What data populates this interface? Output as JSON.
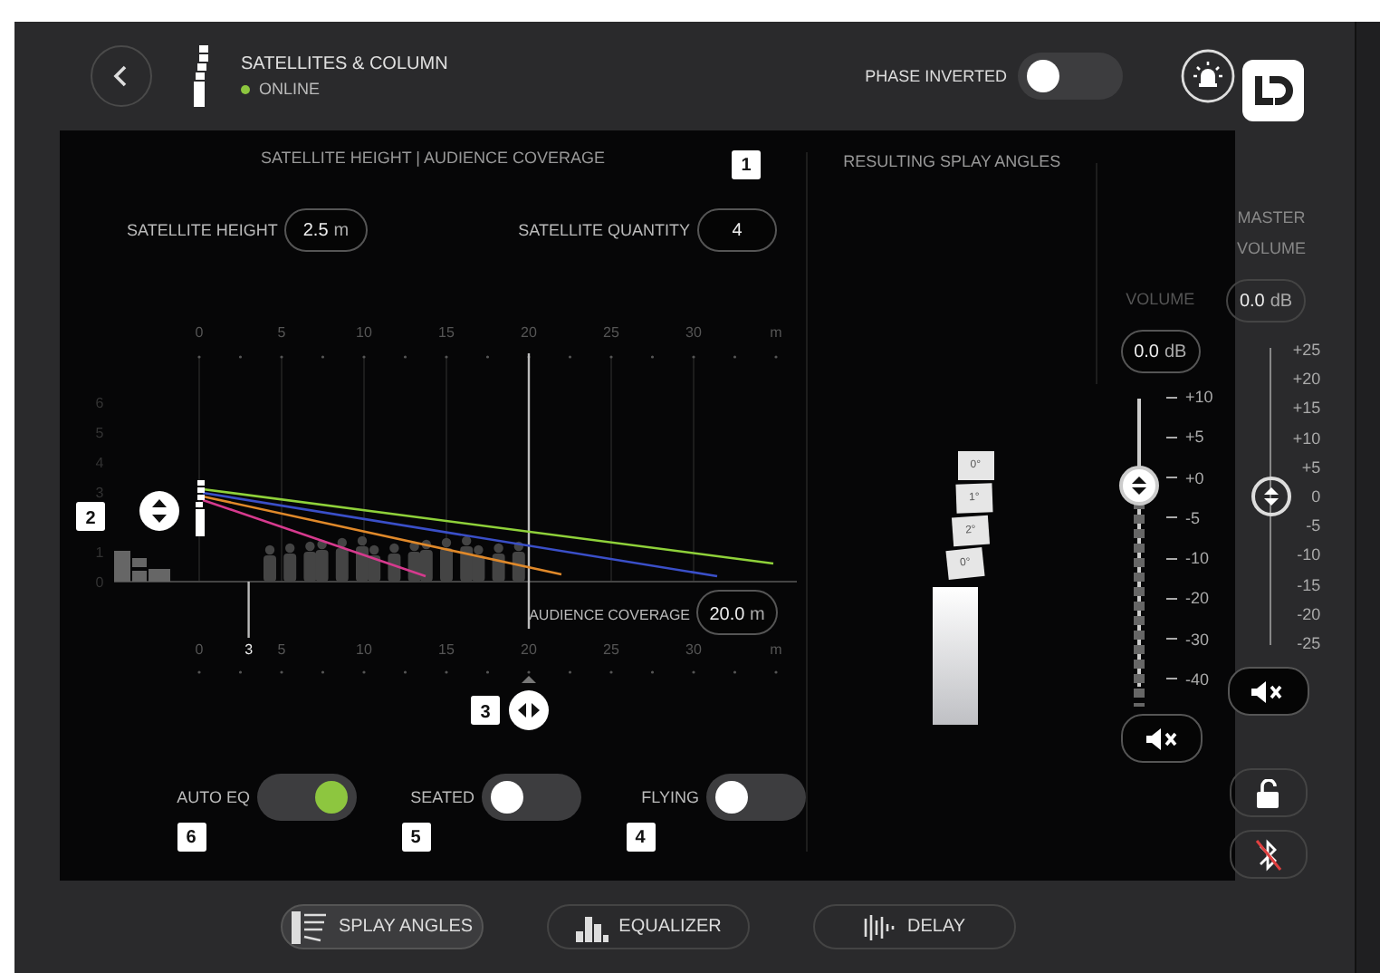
{
  "header": {
    "title": "SATELLITES & COLUMN",
    "status": {
      "label": "ONLINE",
      "online": true
    },
    "phase_inverted": {
      "label": "PHASE INVERTED",
      "on": false
    }
  },
  "coverage": {
    "title": "SATELLITE HEIGHT | AUDIENCE COVERAGE",
    "height_field": {
      "label": "SATELLITE HEIGHT",
      "value": "2.5",
      "unit": "m"
    },
    "quantity_field": {
      "label": "SATELLITE QUANTITY",
      "value": "4",
      "badge": "1"
    },
    "top_axis": [
      "0",
      "5",
      "10",
      "15",
      "20",
      "25",
      "30",
      "m"
    ],
    "height_axis": [
      "6",
      "5",
      "4",
      "3",
      "1",
      "0"
    ],
    "bottom_axis": [
      "0",
      "5",
      "10",
      "15",
      "20",
      "25",
      "30",
      "m"
    ],
    "position_marker": "3",
    "coverage_field": {
      "label": "AUDIENCE COVERAGE",
      "value": "20.0",
      "unit": "m"
    },
    "height_handle": {
      "badge": "2"
    },
    "coverage_handle": {
      "badge": "3"
    },
    "rays": [
      {
        "color": "#8fd13a"
      },
      {
        "color": "#3a4fc8"
      },
      {
        "color": "#e0892a"
      },
      {
        "color": "#d63a8e"
      }
    ],
    "switches": [
      {
        "label": "AUTO EQ",
        "on": true,
        "badge": "6"
      },
      {
        "label": "SEATED",
        "on": false,
        "badge": "5"
      },
      {
        "label": "FLYING",
        "on": false,
        "badge": "4"
      }
    ]
  },
  "splay": {
    "title": "RESULTING SPLAY ANGLES",
    "angles": [
      "0°",
      "1°",
      "2°",
      "0°"
    ]
  },
  "volume": {
    "label": "VOLUME",
    "value": "0.0",
    "unit": "dB",
    "level": 0.7,
    "scale": [
      "+10",
      "+5",
      "+0",
      "-5",
      "-10",
      "-20",
      "-30",
      "-40"
    ]
  },
  "master": {
    "label": "MASTER VOLUME",
    "value": "0.0",
    "unit": "dB",
    "level": 0.5,
    "scale": [
      "+25",
      "+20",
      "+15",
      "+10",
      "+5",
      "0",
      "-5",
      "-10",
      "-15",
      "-20",
      "-25"
    ]
  },
  "tabs": [
    {
      "label": "SPLAY ANGLES",
      "selected": true
    },
    {
      "label": "EQUALIZER",
      "selected": false
    },
    {
      "label": "DELAY",
      "selected": false
    }
  ],
  "bluetooth": {
    "on": false
  }
}
